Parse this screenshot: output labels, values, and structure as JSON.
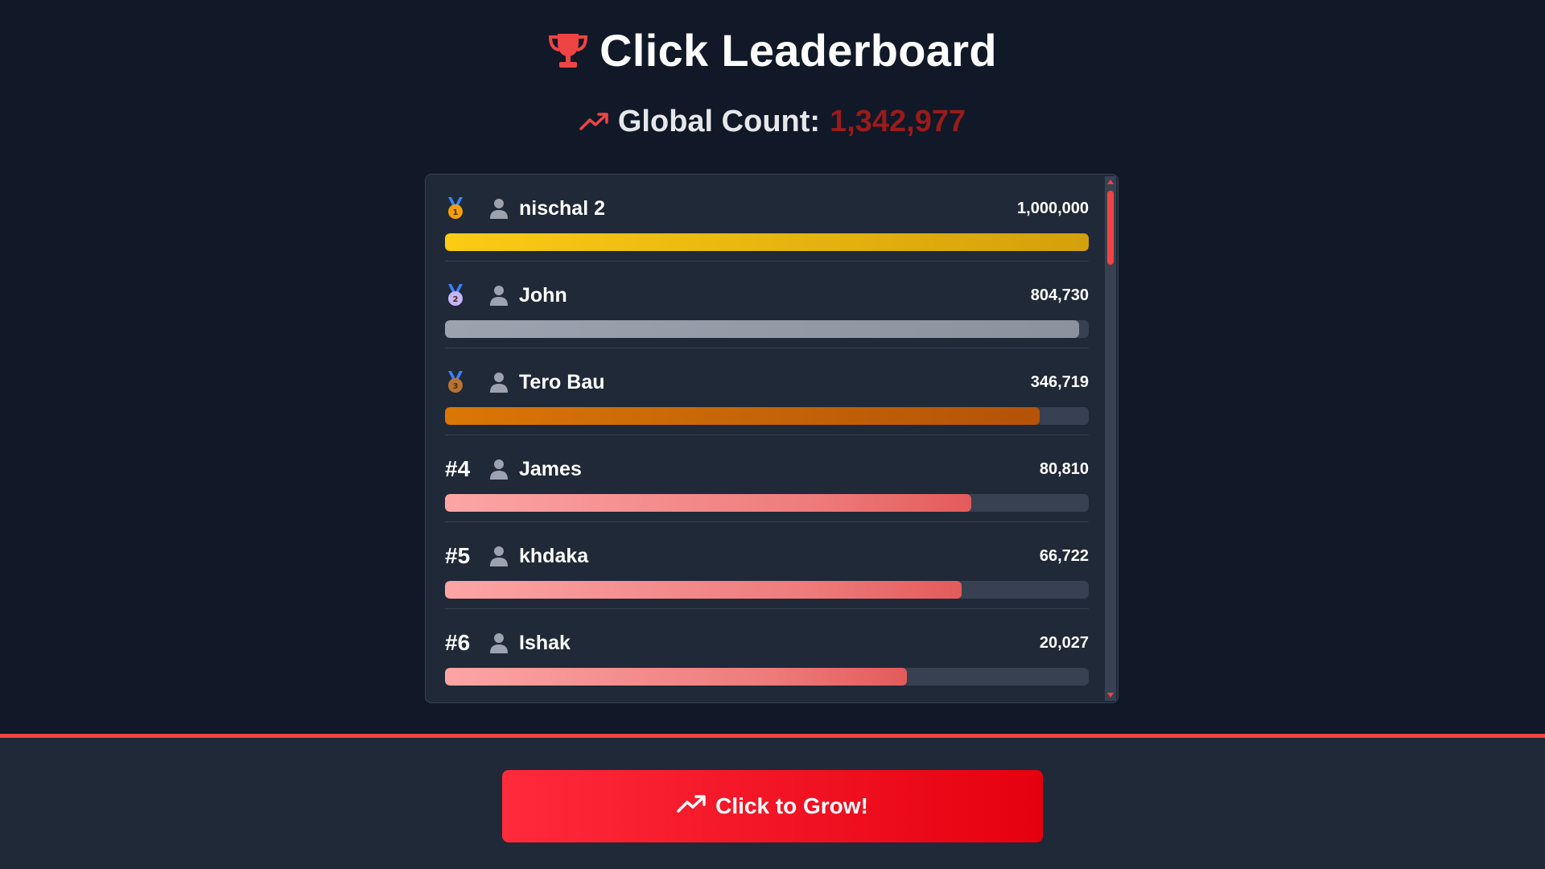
{
  "header": {
    "title": "Click Leaderboard",
    "title_icon": "trophy-icon",
    "global_label": "Global Count:",
    "global_value": "1,342,977",
    "global_icon": "trending-up-icon"
  },
  "colors": {
    "accent": "#ef4444",
    "background": "#111827",
    "panel": "#1f2937",
    "gold": "#facc15",
    "silver": "#9ca3af",
    "bronze": "#d97706",
    "bar_red": "#f87171",
    "global_value": "#991b1b"
  },
  "leaderboard": {
    "entries": [
      {
        "rank_label": "",
        "medal": "gold-medal-icon",
        "name": "nischal 2",
        "count": "1,000,000",
        "bar_fill": 1.0,
        "bar_style": "gold"
      },
      {
        "rank_label": "",
        "medal": "silver-medal-icon",
        "name": "John",
        "count": "804,730",
        "bar_fill": 0.985,
        "bar_style": "silver"
      },
      {
        "rank_label": "",
        "medal": "bronze-medal-icon",
        "name": "Tero Bau",
        "count": "346,719",
        "bar_fill": 0.924,
        "bar_style": "bronze"
      },
      {
        "rank_label": "#4",
        "medal": "",
        "name": "James",
        "count": "80,810",
        "bar_fill": 0.818,
        "bar_style": "red"
      },
      {
        "rank_label": "#5",
        "medal": "",
        "name": "khdaka",
        "count": "66,722",
        "bar_fill": 0.803,
        "bar_style": "red"
      },
      {
        "rank_label": "#6",
        "medal": "",
        "name": "Ishak",
        "count": "20,027",
        "bar_fill": 0.717,
        "bar_style": "red"
      }
    ]
  },
  "footer": {
    "button_label": "Click to Grow!",
    "button_icon": "trending-up-icon"
  }
}
